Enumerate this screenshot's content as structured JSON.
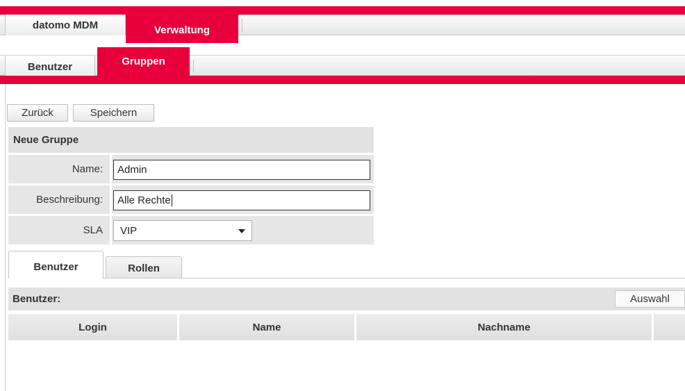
{
  "top_menu": {
    "app_title": "datomo MDM",
    "active_tab": "Verwaltung"
  },
  "sub_menu": {
    "users_tab": "Benutzer",
    "groups_tab": "Gruppen"
  },
  "toolbar": {
    "back_label": "Zurück",
    "save_label": "Speichern"
  },
  "form": {
    "title": "Neue Gruppe",
    "name_label": "Name:",
    "name_value": "Admin",
    "description_label": "Beschreibung:",
    "description_value": "Alle Rechte",
    "sla_label": "SLA",
    "sla_value": "VIP"
  },
  "detail_tabs": {
    "users": "Benutzer",
    "roles": "Rollen"
  },
  "users_section": {
    "title": "Benutzer:",
    "select_button": "Auswahl",
    "columns": [
      "Login",
      "Name",
      "Nachname",
      ""
    ]
  },
  "colors": {
    "accent": "#e8003c"
  }
}
